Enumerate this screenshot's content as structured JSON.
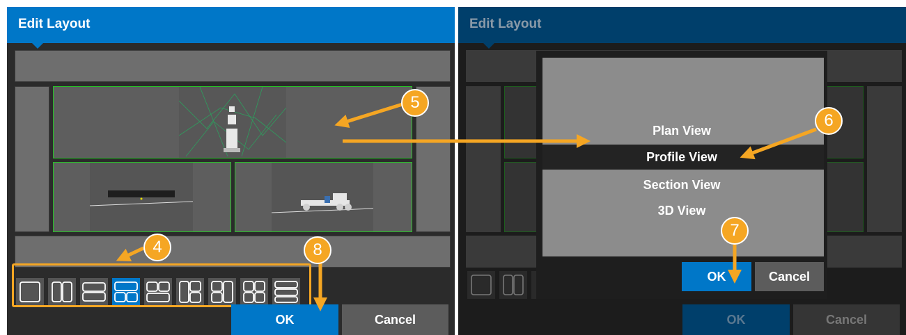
{
  "left_dialog": {
    "title": "Edit Layout",
    "ok_label": "OK",
    "cancel_label": "Cancel",
    "layout_icons": [
      "single-view",
      "two-vertical",
      "two-horizontal",
      "one-top-two-bottom",
      "two-top-one-bottom",
      "one-left-two-right",
      "two-left-one-right",
      "four-grid",
      "three-horizontal"
    ],
    "selected_layout_index": 3
  },
  "right_dialog": {
    "title": "Edit Layout",
    "ok_label": "OK",
    "cancel_label": "Cancel",
    "view_menu": {
      "items": [
        "Plan View",
        "Profile View",
        "Section View",
        "3D View"
      ],
      "selected": "Profile View",
      "ok_label": "OK",
      "cancel_label": "Cancel"
    }
  },
  "callouts": [
    "4",
    "5",
    "6",
    "7",
    "8"
  ],
  "colors": {
    "accent": "#0077c8",
    "callout": "#f5a623",
    "viewport_border": "#27c227"
  }
}
